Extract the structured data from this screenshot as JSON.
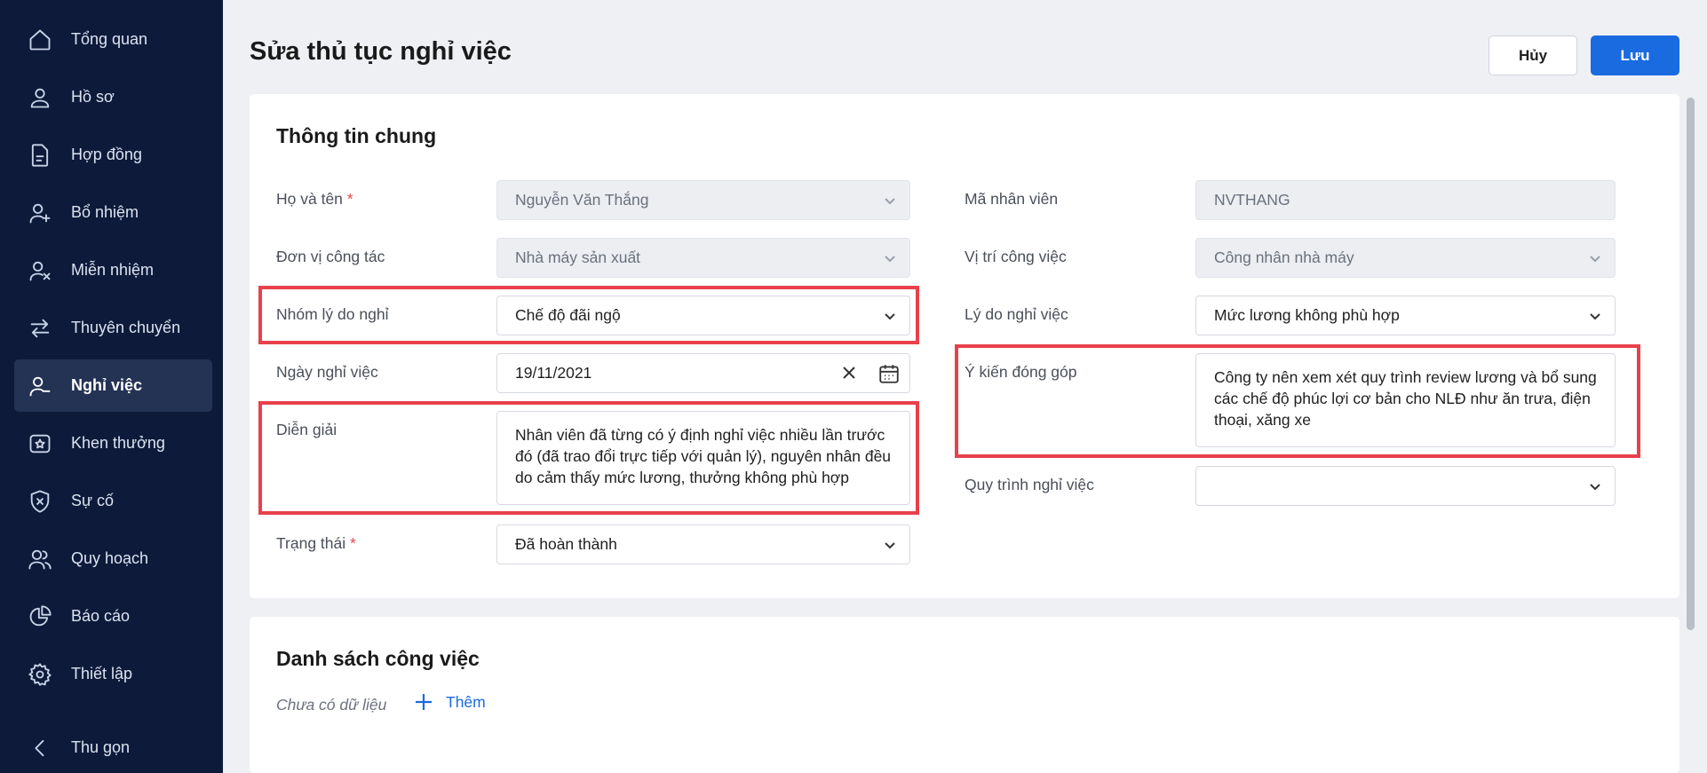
{
  "sidebar": {
    "items": [
      {
        "label": "Tổng quan",
        "icon": "home-icon"
      },
      {
        "label": "Hồ sơ",
        "icon": "user-icon"
      },
      {
        "label": "Hợp đồng",
        "icon": "document-icon"
      },
      {
        "label": "Bổ nhiệm",
        "icon": "user-plus-icon"
      },
      {
        "label": "Miễn nhiệm",
        "icon": "user-x-icon"
      },
      {
        "label": "Thuyên chuyển",
        "icon": "transfer-icon"
      },
      {
        "label": "Nghỉ việc",
        "icon": "user-minus-icon",
        "active": true
      },
      {
        "label": "Khen thưởng",
        "icon": "reward-icon"
      },
      {
        "label": "Sự cố",
        "icon": "shield-x-icon"
      },
      {
        "label": "Quy hoạch",
        "icon": "users-icon"
      },
      {
        "label": "Báo cáo",
        "icon": "pie-chart-icon"
      },
      {
        "label": "Thiết lập",
        "icon": "gear-icon"
      }
    ],
    "collapse_label": "Thu gọn"
  },
  "header": {
    "title": "Sửa thủ tục nghỉ việc",
    "cancel_label": "Hủy",
    "save_label": "Lưu"
  },
  "general": {
    "title": "Thông tin chung",
    "full_name": {
      "label": "Họ và tên",
      "required": "*",
      "value": "Nguyễn Văn Thắng"
    },
    "unit": {
      "label": "Đơn vị công tác",
      "value": "Nhà máy sản xuất"
    },
    "reason_group": {
      "label": "Nhóm lý do nghỉ",
      "value": "Chế độ đãi ngộ"
    },
    "leave_date": {
      "label": "Ngày nghỉ việc",
      "value": "19/11/2021"
    },
    "explanation": {
      "label": "Diễn giải",
      "value": "Nhân viên đã từng có ý định nghỉ việc nhiều lần trước đó (đã trao đổi trực tiếp với quản lý), nguyên nhân đều do cảm thấy mức lương, thưởng không phù hợp"
    },
    "status": {
      "label": "Trạng thái",
      "required": "*",
      "value": "Đã hoàn thành"
    },
    "employee_code": {
      "label": "Mã nhân viên",
      "value": "NVTHANG"
    },
    "position": {
      "label": "Vị trí công việc",
      "value": "Công nhân nhà máy"
    },
    "reason": {
      "label": "Lý do nghỉ việc",
      "value": "Mức lương không phù hợp"
    },
    "feedback": {
      "label": "Ý kiến đóng góp",
      "value": "Công ty nên xem xét quy trình review lương và bổ sung các chế độ phúc lợi cơ bản cho NLĐ như ăn trưa, điện thoại, xăng xe"
    },
    "process": {
      "label": "Quy trình nghỉ việc",
      "value": ""
    }
  },
  "tasks": {
    "title": "Danh sách công việc",
    "empty_text": "Chưa có dữ liệu",
    "add_label": "Thêm"
  },
  "colors": {
    "sidebar_bg": "#0d1a3a",
    "primary": "#1a6ae0",
    "highlight": "#e8414b"
  }
}
